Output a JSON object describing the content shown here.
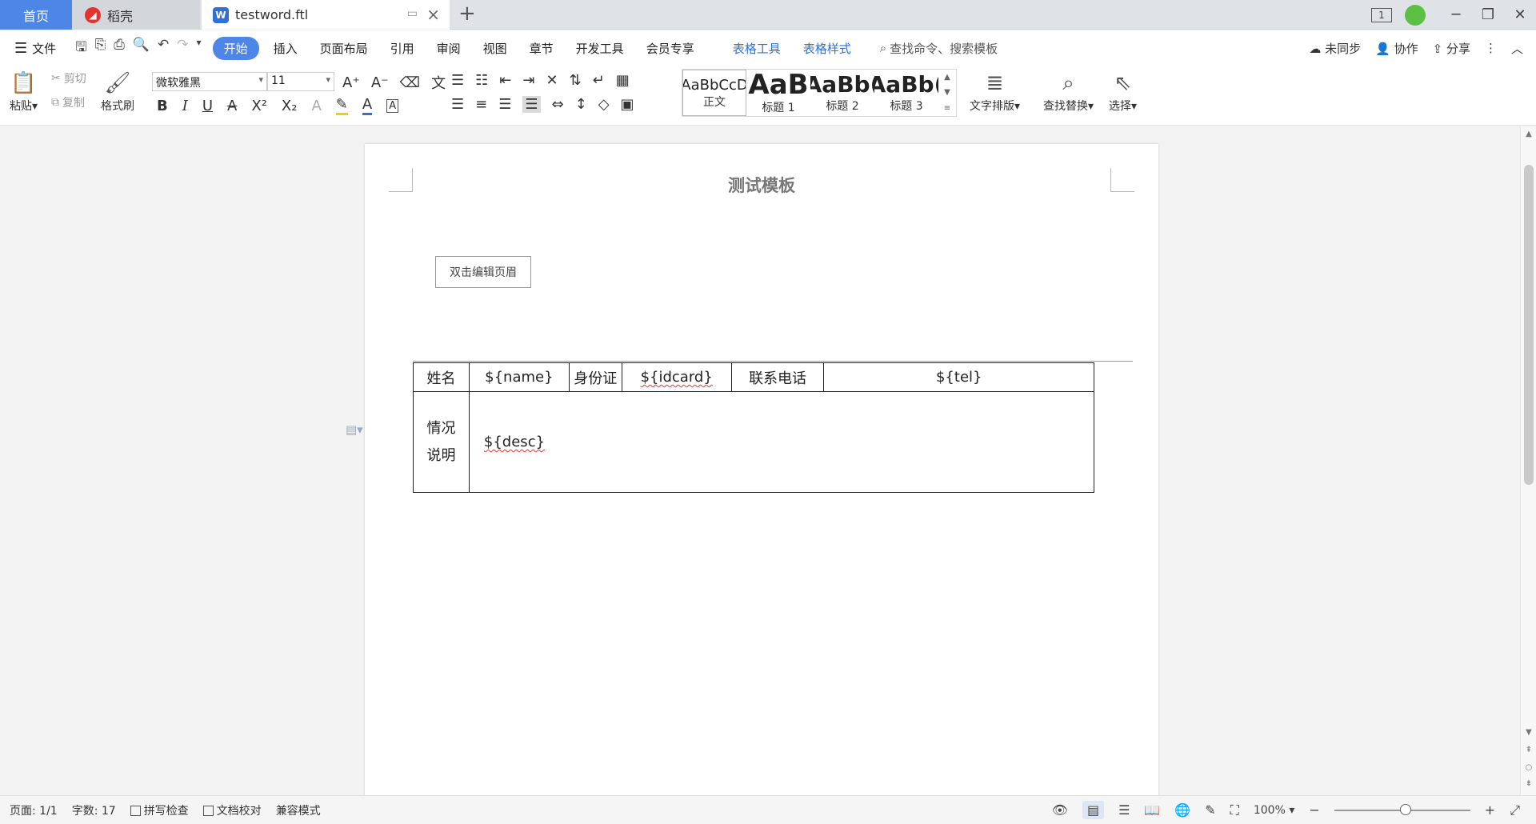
{
  "tabs": {
    "home": "首页",
    "daoke": "稻壳",
    "doc": "testword.ftl"
  },
  "menu": {
    "file": "文件",
    "items": [
      "开始",
      "插入",
      "页面布局",
      "引用",
      "审阅",
      "视图",
      "章节",
      "开发工具",
      "会员专享"
    ],
    "table_tools": "表格工具",
    "table_style": "表格样式",
    "search": "查找命令、搜索模板",
    "sync": "未同步",
    "collab": "协作",
    "share": "分享"
  },
  "ribbon": {
    "paste": "粘贴",
    "cut": "剪切",
    "copy": "复制",
    "format_painter": "格式刷",
    "font": "微软雅黑",
    "size": "11",
    "styles": [
      {
        "preview": "AaBbCcD",
        "label": "正文"
      },
      {
        "preview": "AaB",
        "label": "标题 1"
      },
      {
        "preview": "AaBb(",
        "label": "标题 2"
      },
      {
        "preview": "AaBb(",
        "label": "标题 3"
      }
    ],
    "text_layout": "文字排版",
    "find_replace": "查找替换",
    "select": "选择"
  },
  "document": {
    "title": "测试模板",
    "header_edit": "双击编辑页眉",
    "table": {
      "row1": [
        "姓名",
        "${name}",
        "身份证",
        "${idcard}",
        "联系电话",
        "${tel}"
      ],
      "row2_label_line1": "情况",
      "row2_label_line2": "说明",
      "row2_value": "${desc}"
    }
  },
  "status": {
    "page": "页面: 1/1",
    "words": "字数: 17",
    "spell": "拼写检查",
    "proof": "文档校对",
    "compat": "兼容模式",
    "zoom": "100%"
  }
}
